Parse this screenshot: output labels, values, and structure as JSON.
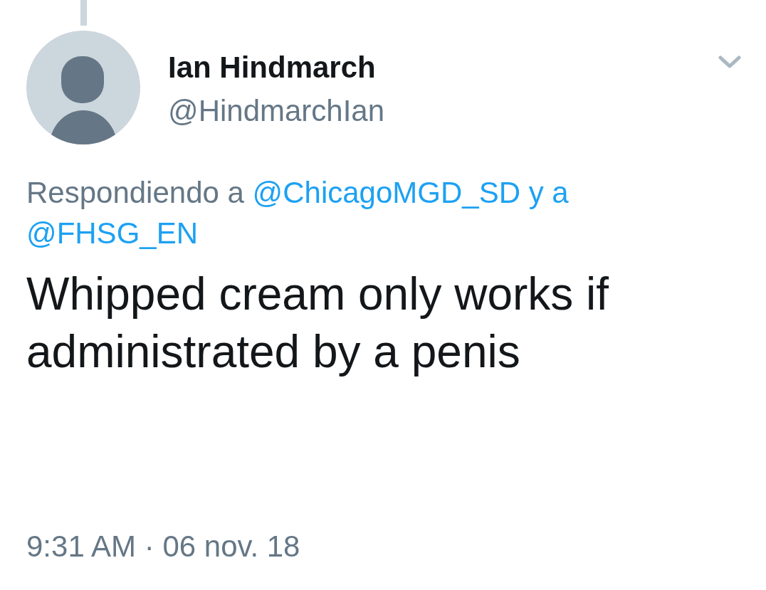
{
  "tweet": {
    "connected_above": true,
    "author": {
      "name": "Ian Hindmarch",
      "handle": "@HindmarchIan"
    },
    "reply_context": {
      "prefix": "Respondiendo a",
      "mentions": [
        "@ChicagoMGD_SD",
        "@FHSG_EN"
      ],
      "joiner": "y a"
    },
    "text": "Whipped cream only works if administrated by a penis",
    "timestamp": "9:31 AM · 06 nov. 18"
  }
}
